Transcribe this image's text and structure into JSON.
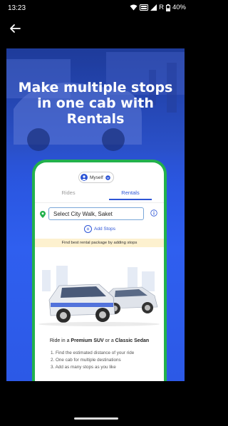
{
  "status_bar": {
    "time": "13:23",
    "battery": "40%",
    "indicator": "R",
    "icons": [
      "wifi-icon",
      "volte-icon",
      "signal-icon",
      "battery-icon"
    ]
  },
  "header": {
    "back_icon": "arrow-left-icon"
  },
  "promo": {
    "title_line1": "Make multiple stops",
    "title_line2": "in one cab with",
    "title_line3": "Rentals",
    "colors": {
      "background": "#2a56e0",
      "phone_border": "#22b14c",
      "accent": "#2d55d6",
      "banner": "#fdf1cf"
    },
    "phone": {
      "profile_label": "Myself",
      "tabs": [
        {
          "label": "Rides",
          "selected": false
        },
        {
          "label": "Rentals",
          "selected": true
        }
      ],
      "search_value": "Select City Walk, Saket",
      "add_stops_label": "Add Stops",
      "banner_text": "Find best rental package by adding stops",
      "ride_title_prefix": "Ride in a ",
      "ride_title_premium": "Premium SUV",
      "ride_title_mid": " or a ",
      "ride_title_sedan": "Classic Sedan",
      "bullets": [
        "1. Find the estimated distance of your ride",
        "2. One cab for multiple destinations",
        "3. Add as many stops as you like"
      ]
    }
  }
}
